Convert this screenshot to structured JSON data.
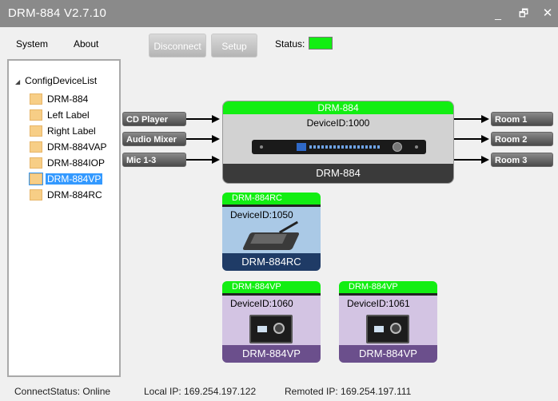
{
  "window": {
    "title": "DRM-884  V2.7.10",
    "minimize": "_",
    "maximize": "🗗",
    "close": "✕"
  },
  "menu": {
    "system": "System",
    "about": "About"
  },
  "toolbar": {
    "disconnect_label": "Disconnect",
    "setup_label": "Setup",
    "status_label": "Status:",
    "status_color": "#12ee12"
  },
  "tree": {
    "root": "ConfigDeviceList",
    "items": [
      {
        "label": "DRM-884"
      },
      {
        "label": "Left Label"
      },
      {
        "label": "Right Label"
      },
      {
        "label": "DRM-884VAP"
      },
      {
        "label": "DRM-884IOP"
      },
      {
        "label": "DRM-884VP",
        "selected": true
      },
      {
        "label": "DRM-884RC"
      }
    ]
  },
  "inputs": [
    "CD Player",
    "Audio Mixer",
    "Mic 1-3"
  ],
  "outputs": [
    "Room 1",
    "Room 2",
    "Room 3"
  ],
  "main_device": {
    "header": "DRM-884",
    "device_id": "DeviceID:1000",
    "footer": "DRM-884"
  },
  "cards": {
    "rc": {
      "header": "DRM-884RC",
      "device_id": "DeviceID:1050",
      "footer": "DRM-884RC"
    },
    "vp1": {
      "header": "DRM-884VP",
      "device_id": "DeviceID:1060",
      "footer": "DRM-884VP"
    },
    "vp2": {
      "header": "DRM-884VP",
      "device_id": "DeviceID:1061",
      "footer": "DRM-884VP"
    }
  },
  "statusbar": {
    "connect": "ConnectStatus:  Online",
    "local_ip": "Local IP:  169.254.197.122",
    "remote_ip": "Remoted IP:  169.254.197.111"
  },
  "colors": {
    "accent_green": "#12ee12",
    "selection_blue": "#3399ff",
    "titlebar": "#8a8a8a"
  }
}
